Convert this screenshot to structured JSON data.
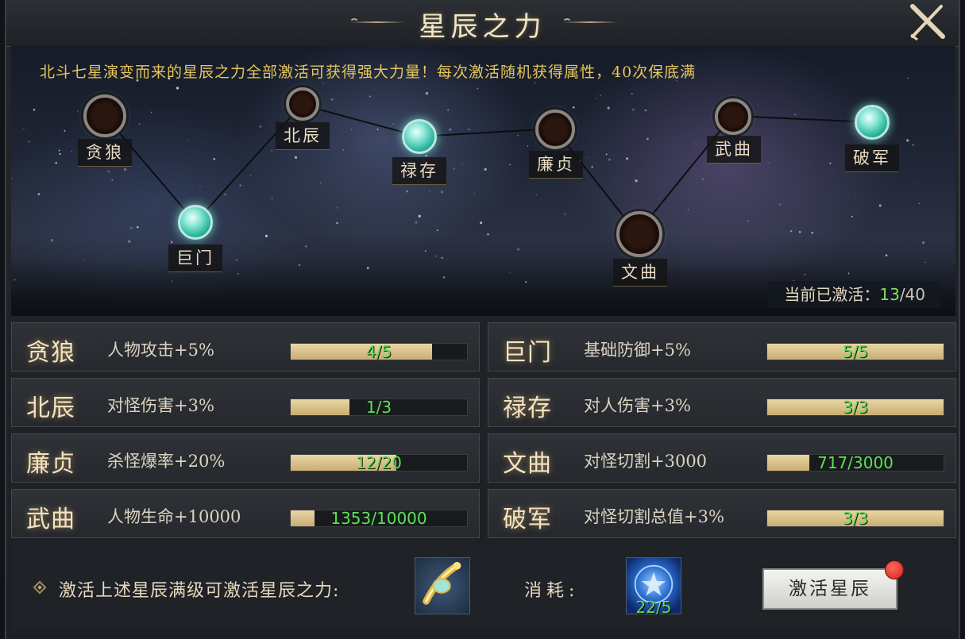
{
  "window": {
    "title": "星辰之力"
  },
  "intro": "北斗七星演变而来的星辰之力全部激活可获得强大力量！每次激活随机获得属性，40次保底满",
  "constellation": [
    {
      "label": "贪狼",
      "active": false
    },
    {
      "label": "巨门",
      "active": true
    },
    {
      "label": "北辰",
      "active": false
    },
    {
      "label": "禄存",
      "active": true
    },
    {
      "label": "廉贞",
      "active": false
    },
    {
      "label": "文曲",
      "active": false
    },
    {
      "label": "武曲",
      "active": false
    },
    {
      "label": "破军",
      "active": true
    }
  ],
  "activated": {
    "label": "当前已激活：",
    "count": "13",
    "total": "/40",
    "value": 13,
    "max": 40
  },
  "rows": [
    {
      "name": "贪狼",
      "attr": "人物攻击+5%",
      "progress": "4/5",
      "fraction": 0.8
    },
    {
      "name": "巨门",
      "attr": "基础防御+5%",
      "progress": "5/5",
      "fraction": 1.0
    },
    {
      "name": "北辰",
      "attr": "对怪伤害+3%",
      "progress": "1/3",
      "fraction": 0.333
    },
    {
      "name": "禄存",
      "attr": "对人伤害+3%",
      "progress": "3/3",
      "fraction": 1.0
    },
    {
      "name": "廉贞",
      "attr": "杀怪爆率+20%",
      "progress": "12/20",
      "fraction": 0.6
    },
    {
      "name": "文曲",
      "attr": "对怪切割+3000",
      "progress": "717/3000",
      "fraction": 0.239
    },
    {
      "name": "武曲",
      "attr": "人物生命+10000",
      "progress": "1353/10000",
      "fraction": 0.135
    },
    {
      "name": "破军",
      "attr": "对怪切割总值+3%",
      "progress": "3/3",
      "fraction": 1.0
    }
  ],
  "footer": {
    "hint": "激活上述星辰满级可激活星辰之力:",
    "reward_icon": "golden-scroll-icon",
    "cost_label": "消耗:",
    "cost_icon": "blue-star-orb-icon",
    "cost_count": "22/5",
    "button_label": "激活星辰"
  },
  "colors": {
    "gold_text": "#e6c65b",
    "progress_green": "#5ee05a",
    "bar_fill": "#d9c08a",
    "active_star": "#6fe0cc",
    "notify_red": "#e0281e"
  }
}
